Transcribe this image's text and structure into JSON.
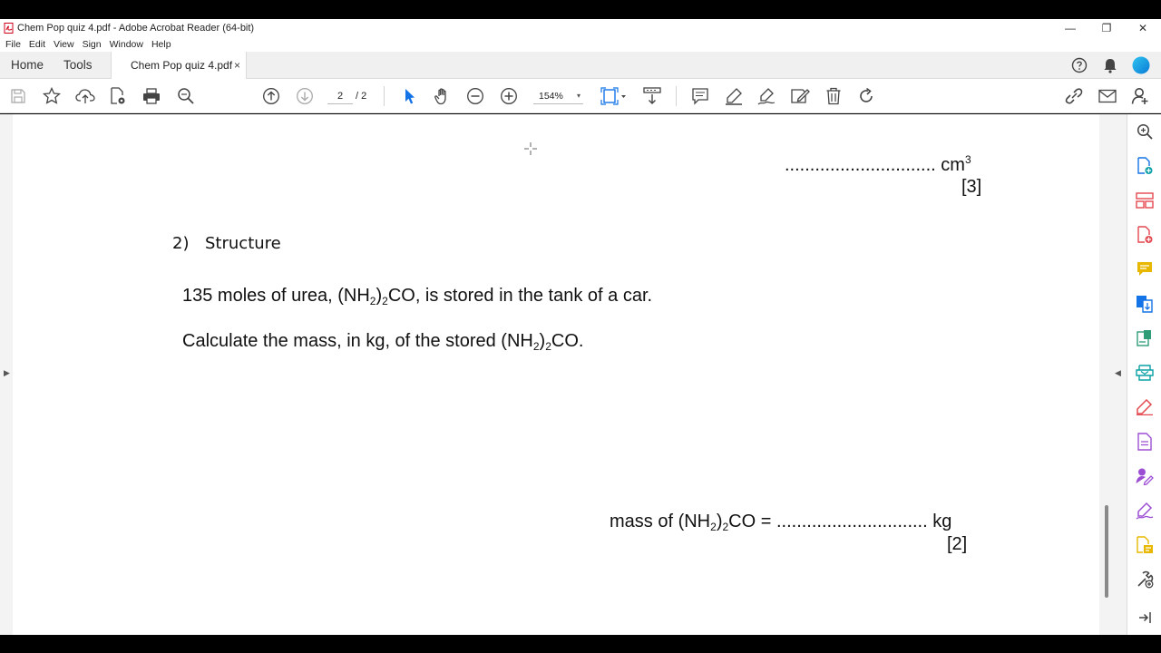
{
  "window": {
    "title": "Chem Pop quiz 4.pdf - Adobe Acrobat Reader (64-bit)",
    "minimize": "—",
    "restore": "❐",
    "close": "✕"
  },
  "menu": [
    "File",
    "Edit",
    "View",
    "Sign",
    "Window",
    "Help"
  ],
  "tabs": {
    "home": "Home",
    "tools": "Tools",
    "document": "Chem Pop quiz 4.pdf",
    "close_glyph": "×"
  },
  "toolbar": {
    "page_current": "2",
    "page_total": "/ 2",
    "zoom": "154%",
    "zoom_caret": "▾"
  },
  "panel_arrows": {
    "left": "▶",
    "right": "◀"
  },
  "document": {
    "answer1_dots": "..............................",
    "answer1_unit": "cm",
    "answer1_unit_sup": "3",
    "marks1": "[3]",
    "question_number": "2)",
    "question_title": "Structure",
    "line1": {
      "a": "135 moles of urea, (NH",
      "sub1": "2",
      "b": ")",
      "sub2": "2",
      "c": "CO, is stored in the tank of a car."
    },
    "line2": {
      "a": "Calculate the mass, in kg, of the stored (NH",
      "sub1": "2",
      "b": ")",
      "sub2": "2",
      "c": "CO."
    },
    "answer2": {
      "a": "mass of (NH",
      "sub1": "2",
      "b": ")",
      "sub2": "2",
      "c": "CO = .............................. kg"
    },
    "marks2": "[2]"
  },
  "colors": {
    "accent_blue": "#1473e6",
    "tool_teal": "#0aa0a6",
    "tool_red": "#e34850",
    "tool_purple": "#9d4fd4",
    "tool_yellow": "#e8b800",
    "tool_green": "#2d9d78"
  }
}
